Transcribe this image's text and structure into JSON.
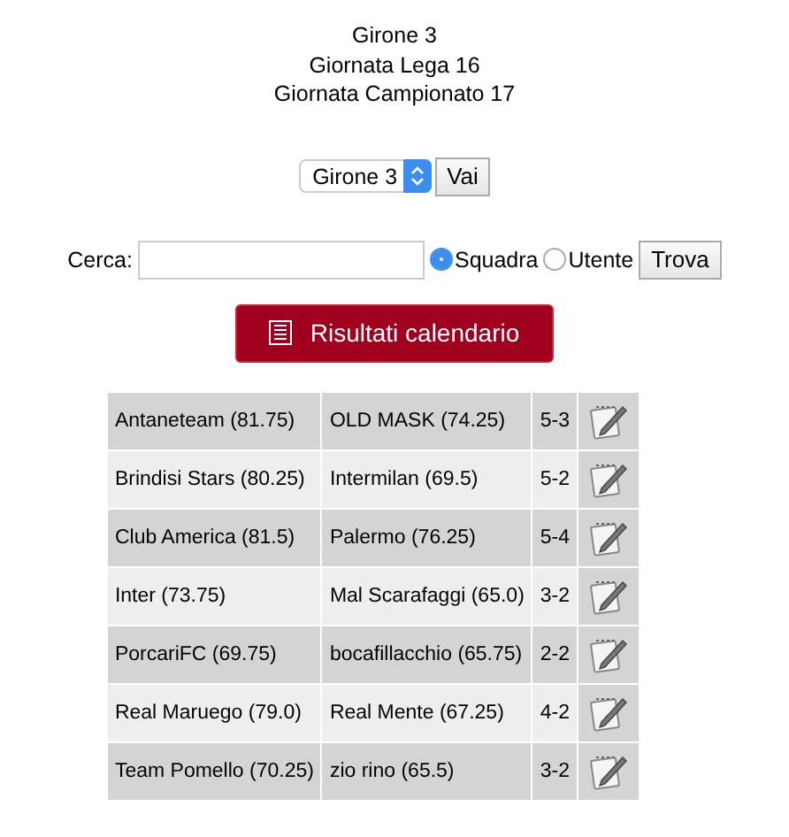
{
  "header": {
    "lines": [
      "Girone 3",
      "Giornata Lega 16",
      "Giornata Campionato 17"
    ]
  },
  "group_select": {
    "value": "Girone 3",
    "button": "Vai"
  },
  "search": {
    "label": "Cerca:",
    "options": [
      {
        "label": "Squadra",
        "selected": true
      },
      {
        "label": "Utente",
        "selected": false
      }
    ],
    "button": "Trova"
  },
  "results_button": {
    "label": "Risultati calendario"
  },
  "matches": [
    {
      "home": "Antaneteam (81.75)",
      "away": "OLD MASK (74.25)",
      "score": "5-3"
    },
    {
      "home": "Brindisi Stars (80.25)",
      "away": "Intermilan (69.5)",
      "score": "5-2"
    },
    {
      "home": "Club America (81.5)",
      "away": "Palermo (76.25)",
      "score": "5-4"
    },
    {
      "home": "Inter (73.75)",
      "away": "Mal Scarafaggi (65.0)",
      "score": "3-2"
    },
    {
      "home": "PorcariFC (69.75)",
      "away": "bocafillacchio (65.75)",
      "score": "2-2"
    },
    {
      "home": "Real Maruego (79.0)",
      "away": "Real Mente (67.25)",
      "score": "4-2"
    },
    {
      "home": "Team Pomello (70.25)",
      "away": "zio rino (65.5)",
      "score": "3-2"
    }
  ]
}
